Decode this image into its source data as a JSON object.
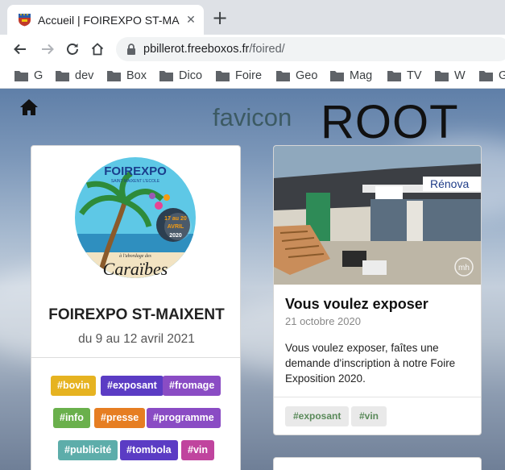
{
  "browser": {
    "tab_title": "Accueil | FOIREXPO ST-MAIXENT",
    "tab_close": "✕",
    "new_tab": "+",
    "url_host": "pbillerot.freeboxos.fr",
    "url_path": "/foired/",
    "bookmarks": [
      "G",
      "dev",
      "Box",
      "Dico",
      "Foire",
      "Geo",
      "Mag",
      "TV",
      "W",
      "G"
    ]
  },
  "header": {
    "favicon_label": "favicon",
    "root_label": "ROOT"
  },
  "event_card": {
    "logo_text": "FOIREXPO",
    "logo_subtext": "SAINT MAIXENT L'ECOLE",
    "logo_date_line1": "17 au 20",
    "logo_date_line2": "AVRIL",
    "logo_year": "2020",
    "logo_tagline": "à l'abordage des",
    "logo_theme": "Caraïbes",
    "title": "FOIREXPO ST-MAIXENT",
    "subtitle": "du 9 au 12 avril 2021",
    "tags": [
      {
        "label": "#bovin",
        "color": "#e6b321"
      },
      {
        "label": "#exposant",
        "color": "#5b3cc4"
      },
      {
        "label": "#fromage",
        "color": "#8a4cc4"
      },
      {
        "label": "#info",
        "color": "#6ab04c"
      },
      {
        "label": "#presse",
        "color": "#e67e22"
      },
      {
        "label": "#programme",
        "color": "#8a4cc4"
      },
      {
        "label": "#publicité",
        "color": "#5dadaa"
      },
      {
        "label": "#tombola",
        "color": "#5b3cc4"
      },
      {
        "label": "#vin",
        "color": "#c0449e"
      }
    ]
  },
  "post_card": {
    "photo_sign": "Rénova",
    "photo_watermark": "mh",
    "title": "Vous voulez exposer",
    "date": "21 octobre 2020",
    "text": "Vous voulez exposer, faîtes une demande d'inscription à notre Foire Exposition 2020.",
    "tags": [
      "#exposant",
      "#vin"
    ]
  }
}
